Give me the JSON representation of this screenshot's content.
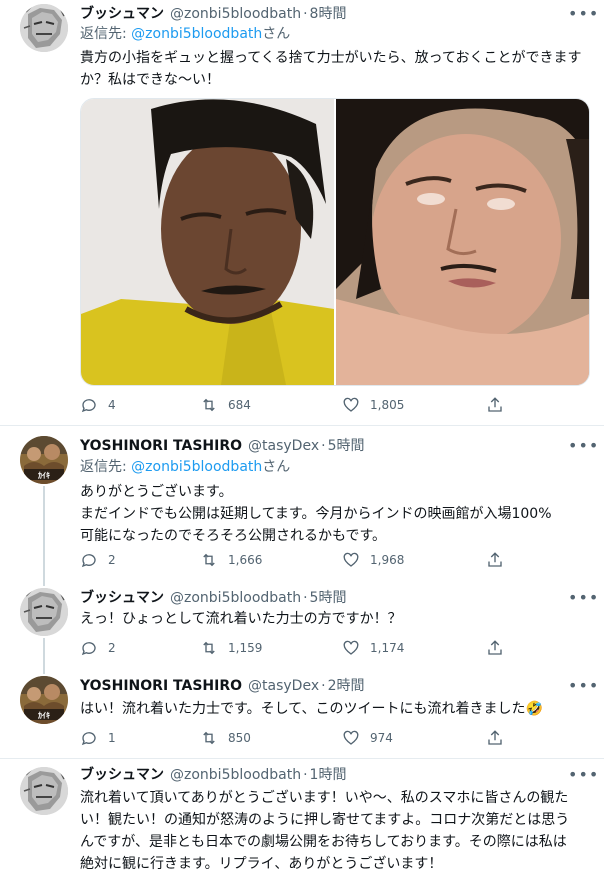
{
  "tweets": [
    {
      "name": "ブッシュマン",
      "handle": "@zonbi5bloodbath",
      "time": "8時間",
      "reply_prefix": "返信先: ",
      "reply_target": "@zonbi5bloodbath",
      "reply_suffix": "さん",
      "text": "貴方の小指をギュッと握ってくる捨て力士がいたら、放っておくことができますか？私はできな〜い！",
      "counts": {
        "reply": "4",
        "retweet": "684",
        "like": "1,805"
      }
    },
    {
      "name": "YOSHINORI TASHIRO",
      "handle": "@tasyDex",
      "time": "5時間",
      "reply_prefix": "返信先: ",
      "reply_target": "@zonbi5bloodbath",
      "reply_suffix": "さん",
      "lines": [
        "ありがとうございます。",
        "まだインドでも公開は延期してます。今月からインドの映画館が入場100%",
        "可能になったのでそろそろ公開されるかもです。"
      ],
      "counts": {
        "reply": "2",
        "retweet": "1,666",
        "like": "1,968"
      }
    },
    {
      "name": "ブッシュマン",
      "handle": "@zonbi5bloodbath",
      "time": "5時間",
      "text": "えっ！ひょっとして流れ着いた力士の方ですか！？",
      "counts": {
        "reply": "2",
        "retweet": "1,159",
        "like": "1,174"
      }
    },
    {
      "name": "YOSHINORI TASHIRO",
      "handle": "@tasyDex",
      "time": "2時間",
      "text": "はい！流れ着いた力士です。そして、このツイートにも流れ着きました🤣",
      "counts": {
        "reply": "1",
        "retweet": "850",
        "like": "974"
      }
    },
    {
      "name": "ブッシュマン",
      "handle": "@zonbi5bloodbath",
      "time": "1時間",
      "text": "流れ着いて頂いてありがとうございます！いや〜、私のスマホに皆さんの観たい！観たい！の通知が怒涛のように押し寄せてますよ。コロナ次第だとは思うんですが、是非とも日本での劇場公開をお待ちしております。その際には私は絶対に観に行きます。リプライ、ありがとうございます！"
    }
  ],
  "separator": "·",
  "colors": {
    "accent": "#1d9bf0",
    "secondary": "#536471",
    "text": "#0f1419"
  },
  "icons": [
    "more-icon",
    "reply-icon",
    "retweet-icon",
    "like-icon",
    "share-icon"
  ]
}
